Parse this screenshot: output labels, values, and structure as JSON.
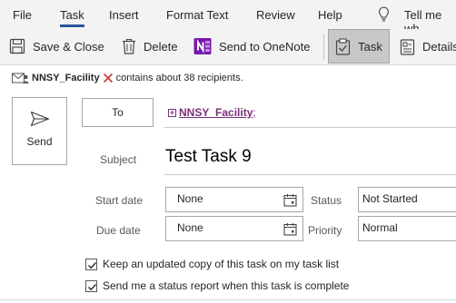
{
  "menu": {
    "items": [
      "File",
      "Task",
      "Insert",
      "Format Text",
      "Review",
      "Help"
    ],
    "tell_me": "Tell me wh"
  },
  "ribbon": {
    "save_close": "Save & Close",
    "delete": "Delete",
    "send_onenote": "Send to OneNote",
    "task": "Task",
    "details": "Details"
  },
  "info_bar": {
    "group_name": "NNSY_Facility",
    "message": "contains about 38 recipients."
  },
  "compose": {
    "send_label": "Send",
    "to_label": "To",
    "recipient": "NNSY_Facility",
    "recipient_sep": ";",
    "subject_label": "Subject",
    "subject_value": "Test Task 9",
    "start_date_label": "Start date",
    "start_date_value": "None",
    "due_date_label": "Due date",
    "due_date_value": "None",
    "status_label": "Status",
    "status_value": "Not Started",
    "priority_label": "Priority",
    "priority_value": "Normal"
  },
  "options": {
    "keep_copy": {
      "label": "Keep an updated copy of this task on my task list",
      "checked": true
    },
    "status_report": {
      "label": "Send me a status report when this task is complete",
      "checked": true
    }
  },
  "colors": {
    "accent": "#2b579a",
    "onenote": "#7719aa",
    "recipient": "#7a2f7a",
    "error": "#d13438"
  }
}
